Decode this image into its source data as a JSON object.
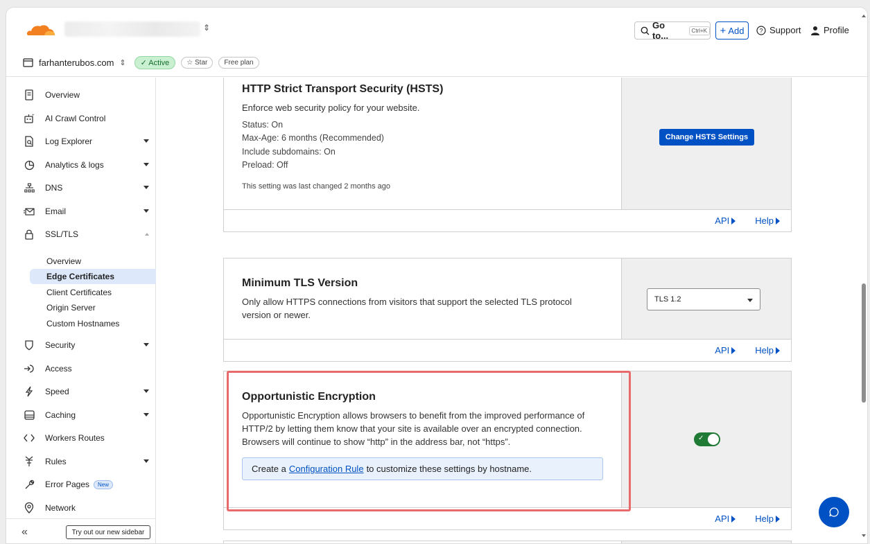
{
  "topbar": {
    "goto_label": "Go to...",
    "goto_shortcut": "Ctrl+K",
    "add_label": "Add",
    "support_label": "Support",
    "profile_label": "Profile"
  },
  "domainbar": {
    "domain": "farhanterubos.com",
    "status": "Active",
    "star_label": "Star",
    "plan": "Free plan"
  },
  "sidebar": {
    "items": [
      {
        "label": "Overview",
        "icon": "document-icon"
      },
      {
        "label": "AI Crawl Control",
        "icon": "robot-icon"
      },
      {
        "label": "Log Explorer",
        "icon": "file-search-icon"
      },
      {
        "label": "Analytics & logs",
        "icon": "pie-chart-icon"
      },
      {
        "label": "DNS",
        "icon": "network-icon"
      },
      {
        "label": "Email",
        "icon": "email-icon"
      },
      {
        "label": "SSL/TLS",
        "icon": "lock-icon"
      },
      {
        "label": "Security",
        "icon": "shield-icon"
      },
      {
        "label": "Access",
        "icon": "access-icon"
      },
      {
        "label": "Speed",
        "icon": "lightning-icon"
      },
      {
        "label": "Caching",
        "icon": "storage-icon"
      },
      {
        "label": "Workers Routes",
        "icon": "code-icon"
      },
      {
        "label": "Rules",
        "icon": "rules-icon"
      },
      {
        "label": "Error Pages",
        "icon": "wrench-icon"
      },
      {
        "label": "Network",
        "icon": "location-icon"
      }
    ],
    "ssl_sub": [
      "Overview",
      "Edge Certificates",
      "Client Certificates",
      "Origin Server",
      "Custom Hostnames"
    ],
    "new_badge": "New",
    "try_label": "Try out our new sidebar"
  },
  "hsts": {
    "title": "HTTP Strict Transport Security (HSTS)",
    "desc": "Enforce web security policy for your website.",
    "status": "Status: On",
    "max_age": "Max-Age: 6 months (Recommended)",
    "subdomains": "Include subdomains: On",
    "preload": "Preload: Off",
    "changed": "This setting was last changed 2 months ago",
    "button": "Change HSTS Settings"
  },
  "tls": {
    "title": "Minimum TLS Version",
    "desc_1": "Only allow HTTPS connections from visitors that support the selected TLS protocol",
    "desc_2": "version or newer.",
    "selected": "TLS 1.2"
  },
  "oe": {
    "title": "Opportunistic Encryption",
    "desc_1": "Opportunistic Encryption allows browsers to benefit from the improved performance of",
    "desc_2": "HTTP/2 by letting them know that your site is available over an encrypted connection.",
    "desc_3": "Browsers will continue to show “http” in the address bar, not “https”.",
    "info_pre": "Create a",
    "info_link": "Configuration Rule",
    "info_post": "to customize these settings by hostname.",
    "enabled": true
  },
  "footer": {
    "api": "API",
    "help": "Help"
  },
  "colors": {
    "accent": "#0051c3",
    "toggle_on": "#1f7a35",
    "highlight": "#e86a6a"
  }
}
